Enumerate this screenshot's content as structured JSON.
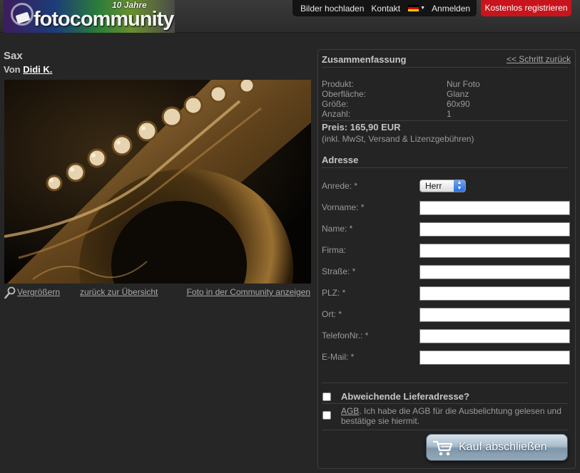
{
  "header": {
    "anniversary": "10 Jahre",
    "brand": "fotocommunity",
    "nav": [
      "Bilder hochladen",
      "Kontakt"
    ],
    "login": "Anmelden",
    "register": "Kostenlos registrieren",
    "flag_icon": "german-flag-icon"
  },
  "photo": {
    "title": "Sax",
    "by_prefix": "Von",
    "author": "Didi K.",
    "links": {
      "enlarge": "Vergrößern",
      "overview": "zurück zur Übersicht",
      "community": "Foto in der Community anzeigen"
    }
  },
  "summary": {
    "title": "Zusammenfassung",
    "back": "<< Schritt zurück",
    "rows": [
      {
        "label": "Produkt:",
        "value": "Nur Foto"
      },
      {
        "label": "Oberfläche:",
        "value": "Glanz"
      },
      {
        "label": "Größe:",
        "value": "60x90"
      },
      {
        "label": "Anzahl:",
        "value": "1"
      }
    ],
    "price": "Preis: 165,90 EUR",
    "price_note": "(inkl. MwSt, Versand & Lizenzgebühren)"
  },
  "address": {
    "title": "Adresse",
    "salutation_label": "Anrede: *",
    "salutation_value": "Herr",
    "fields": [
      {
        "label": "Vorname: *",
        "value": ""
      },
      {
        "label": "Name: *",
        "value": ""
      },
      {
        "label": "Firma:",
        "value": ""
      },
      {
        "label": "Straße: *",
        "value": ""
      },
      {
        "label": "PLZ: *",
        "value": ""
      },
      {
        "label": "Ort: *",
        "value": ""
      },
      {
        "label": "TelefonNr.: *",
        "value": ""
      },
      {
        "label": "E-Mail: *",
        "value": ""
      }
    ]
  },
  "checkout": {
    "alt_address": "Abweichende Lieferadresse?",
    "agb_link": "AGB",
    "agb_text": ". Ich habe die AGB für die Ausbelichtung gelesen und bestätige sie hiermit.",
    "buy": "Kauf abschließen"
  },
  "colors": {
    "background": "#262626",
    "register": "#c8141c",
    "button": "#93a9b9"
  }
}
